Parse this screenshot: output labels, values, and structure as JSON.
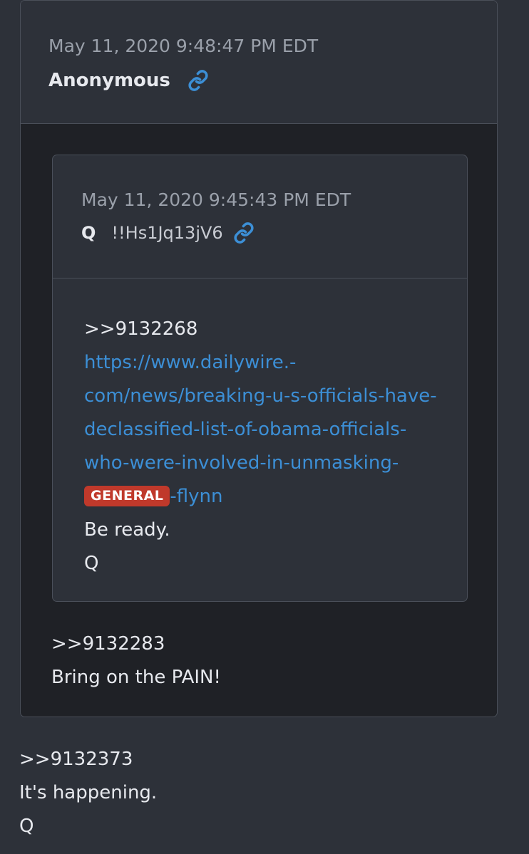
{
  "outer_post": {
    "timestamp": "May 11, 2020 9:48:47 PM EDT",
    "author": "Anonymous",
    "link_icon": "link-icon",
    "body": {
      "ref": ">>9132283",
      "text": "Bring on the PAIN!"
    }
  },
  "quoted_post": {
    "timestamp": "May 11, 2020 9:45:43 PM EDT",
    "author": "Q",
    "tripcode": "!!Hs1Jq13jV6",
    "link_icon": "link-icon",
    "body": {
      "ref": ">>9132268",
      "url_lines": [
        "https://www.dailywire.-",
        "com/news/breaking-u-s-officials-have-",
        "declassified-list-of-obama-officials-",
        "who-were-involved-in-unmasking-"
      ],
      "badge": "GENERAL",
      "url_tail": "-flynn",
      "line1": "Be ready.",
      "signature": "Q"
    }
  },
  "bottom_post": {
    "ref": ">>9132373",
    "text": "It's happening.",
    "signature": "Q"
  },
  "colors": {
    "background": "#2d3139",
    "card_dark": "#1f2126",
    "link": "#3c8fd6",
    "badge": "#c0392b",
    "text": "#e7e9ee",
    "muted": "#9aa0aa"
  }
}
